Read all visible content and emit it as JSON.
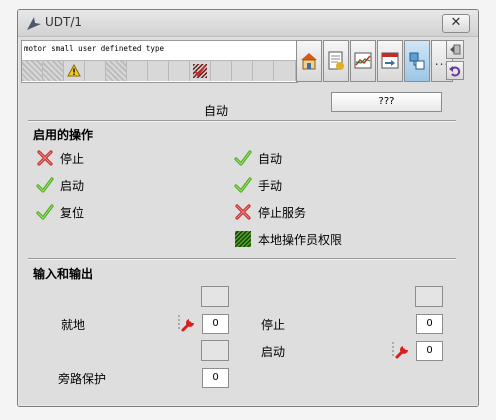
{
  "window": {
    "title": "UDT/1",
    "close_label": "✕"
  },
  "header": {
    "type_name": "motor small user defineted type"
  },
  "status_cells": [
    "hatched",
    "hatched",
    "warning",
    "plain",
    "hatched",
    "plain",
    "plain",
    "plain",
    "hatched-red",
    "plain",
    "plain",
    "plain",
    "plain"
  ],
  "toolbar": {
    "buttons": [
      "home-icon",
      "document-icon",
      "trend-icon",
      "faceplate-icon",
      "loop-icon"
    ],
    "more_label": "...",
    "mini": [
      "arrow-icon",
      "undo-icon"
    ]
  },
  "mode": {
    "label": "自动",
    "button_label": "???"
  },
  "operations": {
    "title": "启用的操作",
    "left": [
      {
        "label": "停止",
        "icon": "red-x-icon"
      },
      {
        "label": "启动",
        "icon": "check-icon"
      },
      {
        "label": "复位",
        "icon": "check-icon"
      }
    ],
    "right": [
      {
        "label": "自动",
        "icon": "check-icon"
      },
      {
        "label": "手动",
        "icon": "check-icon"
      },
      {
        "label": "停止服务",
        "icon": "red-x-icon"
      },
      {
        "label": "本地操作员权限",
        "icon": "hatched-check-icon"
      }
    ]
  },
  "io": {
    "title": "输入和输出",
    "local_label": "就地",
    "local_value": "0",
    "bypass_label": "旁路保护",
    "bypass_value": "0",
    "stop_label": "停止",
    "stop_value": "0",
    "start_label": "启动",
    "start_value": "0"
  },
  "colors": {
    "check": "#4caf1f",
    "cross": "#c62b2b",
    "wrench": "#d81e1e"
  }
}
